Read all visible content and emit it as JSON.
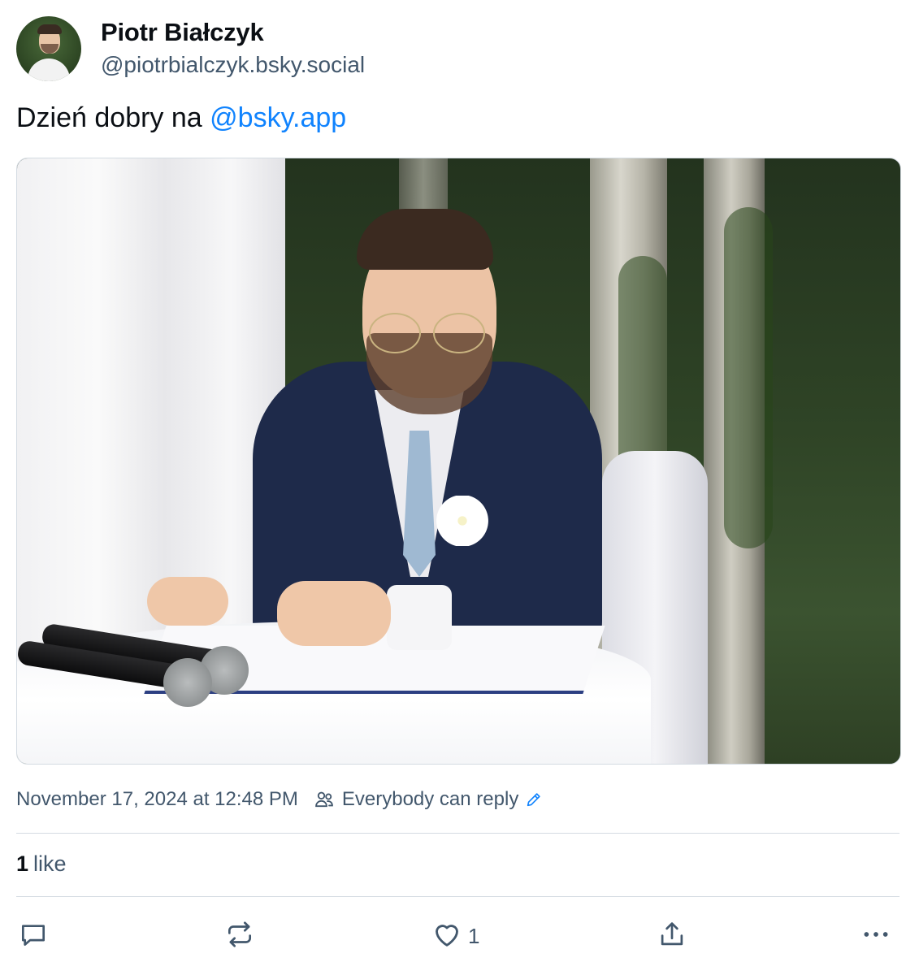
{
  "author": {
    "display_name": "Piotr Białczyk",
    "handle": "@piotrbialczyk.bsky.social"
  },
  "post": {
    "text_prefix": "Dzień dobry na ",
    "mention": "@bsky.app",
    "image_icon": "photo"
  },
  "meta": {
    "timestamp": "November 17, 2024 at 12:48 PM",
    "reply_setting": "Everybody can reply",
    "reply_icon": "people-icon",
    "edit_icon": "pencil-icon"
  },
  "stats": {
    "likes_count": "1",
    "likes_word": "like"
  },
  "actions": {
    "reply_icon": "comment-icon",
    "repost_icon": "repost-icon",
    "like_icon": "heart-icon",
    "like_count": "1",
    "share_icon": "share-icon",
    "more_icon": "ellipsis-icon"
  },
  "colors": {
    "mention": "#1083fe",
    "muted": "#42576c",
    "divider": "#d4dbe2"
  }
}
